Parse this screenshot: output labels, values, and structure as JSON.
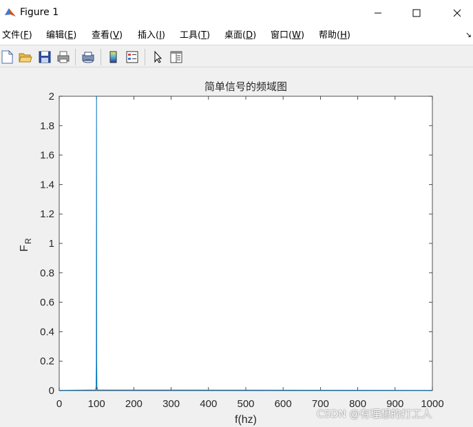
{
  "window": {
    "title": "Figure 1",
    "icons": {
      "app": "matlab-icon",
      "minimize": "minimize-icon",
      "maximize": "maximize-icon",
      "close": "close-icon"
    }
  },
  "menu": {
    "items": [
      {
        "label": "文件(",
        "key": "F",
        "tail": ")"
      },
      {
        "label": "编辑(",
        "key": "E",
        "tail": ")"
      },
      {
        "label": "查看(",
        "key": "V",
        "tail": ")"
      },
      {
        "label": "插入(",
        "key": "I",
        "tail": ")"
      },
      {
        "label": "工具(",
        "key": "T",
        "tail": ")"
      },
      {
        "label": "桌面(",
        "key": "D",
        "tail": ")"
      },
      {
        "label": "窗口(",
        "key": "W",
        "tail": ")"
      },
      {
        "label": "帮助(",
        "key": "H",
        "tail": ")"
      }
    ],
    "more_glyph": "↘"
  },
  "toolbar": {
    "icons": [
      "new-file-icon",
      "open-folder-icon",
      "save-icon",
      "print-icon",
      "link-print-icon",
      "colorbar-icon",
      "legend-icon",
      "pointer-icon",
      "property-editor-icon"
    ]
  },
  "chart_data": {
    "type": "line",
    "title": "简单信号的频域图",
    "xlabel": "f(hz)",
    "ylabel_main": "F",
    "ylabel_sub": "R",
    "xlim": [
      0,
      1000
    ],
    "ylim": [
      0,
      2
    ],
    "xticks": [
      0,
      100,
      200,
      300,
      400,
      500,
      600,
      700,
      800,
      900,
      1000
    ],
    "yticks": [
      0,
      0.2,
      0.4,
      0.6,
      0.8,
      1,
      1.2,
      1.4,
      1.6,
      1.8,
      2
    ],
    "ytick_labels": [
      "0",
      "0.2",
      "0.4",
      "0.6",
      "0.8",
      "1",
      "1.2",
      "1.4",
      "1.6",
      "1.8",
      "2"
    ],
    "grid": false,
    "series": [
      {
        "color": "#0072bd",
        "x": [
          0,
          97,
          98,
          99,
          99.5,
          100,
          100.5,
          101,
          102,
          103,
          1000
        ],
        "y": [
          0.002,
          0.004,
          0.01,
          0.03,
          0.2,
          2.0,
          0.2,
          0.03,
          0.01,
          0.004,
          0.002
        ]
      }
    ]
  },
  "watermark": "CSDN @有理想的打工人"
}
